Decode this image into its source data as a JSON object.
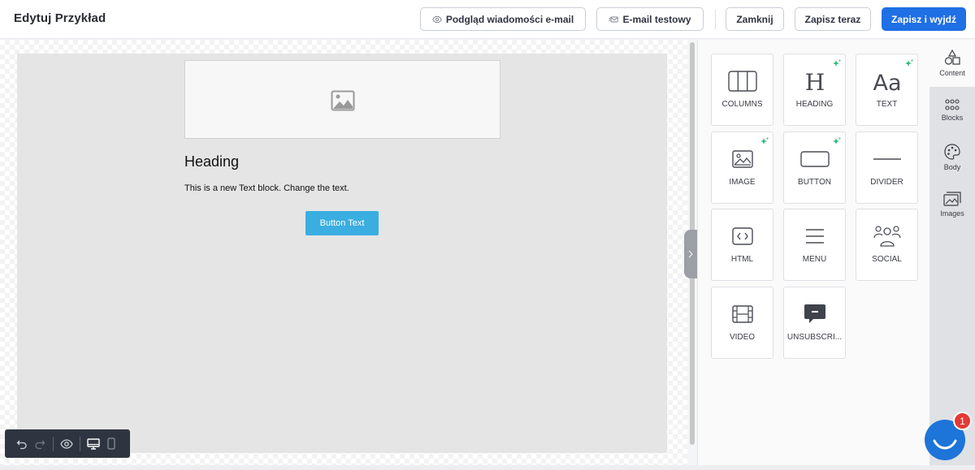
{
  "header": {
    "title": "Edytuj Przykład",
    "preview_label": "Podgląd wiadomości e-mail",
    "test_email_label": "E-mail testowy",
    "close_label": "Zamknij",
    "save_now_label": "Zapisz teraz",
    "save_exit_label": "Zapisz i wyjdź"
  },
  "email": {
    "heading": "Heading",
    "text": "This is a new Text block. Change the text.",
    "button": "Button Text",
    "button_color": "#3aaee0"
  },
  "content_tiles": [
    {
      "label": "COLUMNS",
      "icon": "columns-icon"
    },
    {
      "label": "HEADING",
      "icon": "heading-icon"
    },
    {
      "label": "TEXT",
      "icon": "text-icon"
    },
    {
      "label": "IMAGE",
      "icon": "image-icon"
    },
    {
      "label": "BUTTON",
      "icon": "button-icon"
    },
    {
      "label": "DIVIDER",
      "icon": "divider-icon"
    },
    {
      "label": "HTML",
      "icon": "html-icon"
    },
    {
      "label": "MENU",
      "icon": "menu-icon"
    },
    {
      "label": "SOCIAL",
      "icon": "social-icon"
    },
    {
      "label": "VIDEO",
      "icon": "video-icon"
    },
    {
      "label": "UNSUBSCRI...",
      "icon": "unsubscribe-icon"
    }
  ],
  "side_tabs": [
    {
      "label": "Content",
      "icon": "shapes-icon"
    },
    {
      "label": "Blocks",
      "icon": "blocks-icon"
    },
    {
      "label": "Body",
      "icon": "palette-icon"
    },
    {
      "label": "Images",
      "icon": "images-icon"
    }
  ],
  "chat": {
    "badge": "1"
  },
  "colors": {
    "primary": "#1f6fe5",
    "accent_spark": "#2bb673"
  }
}
